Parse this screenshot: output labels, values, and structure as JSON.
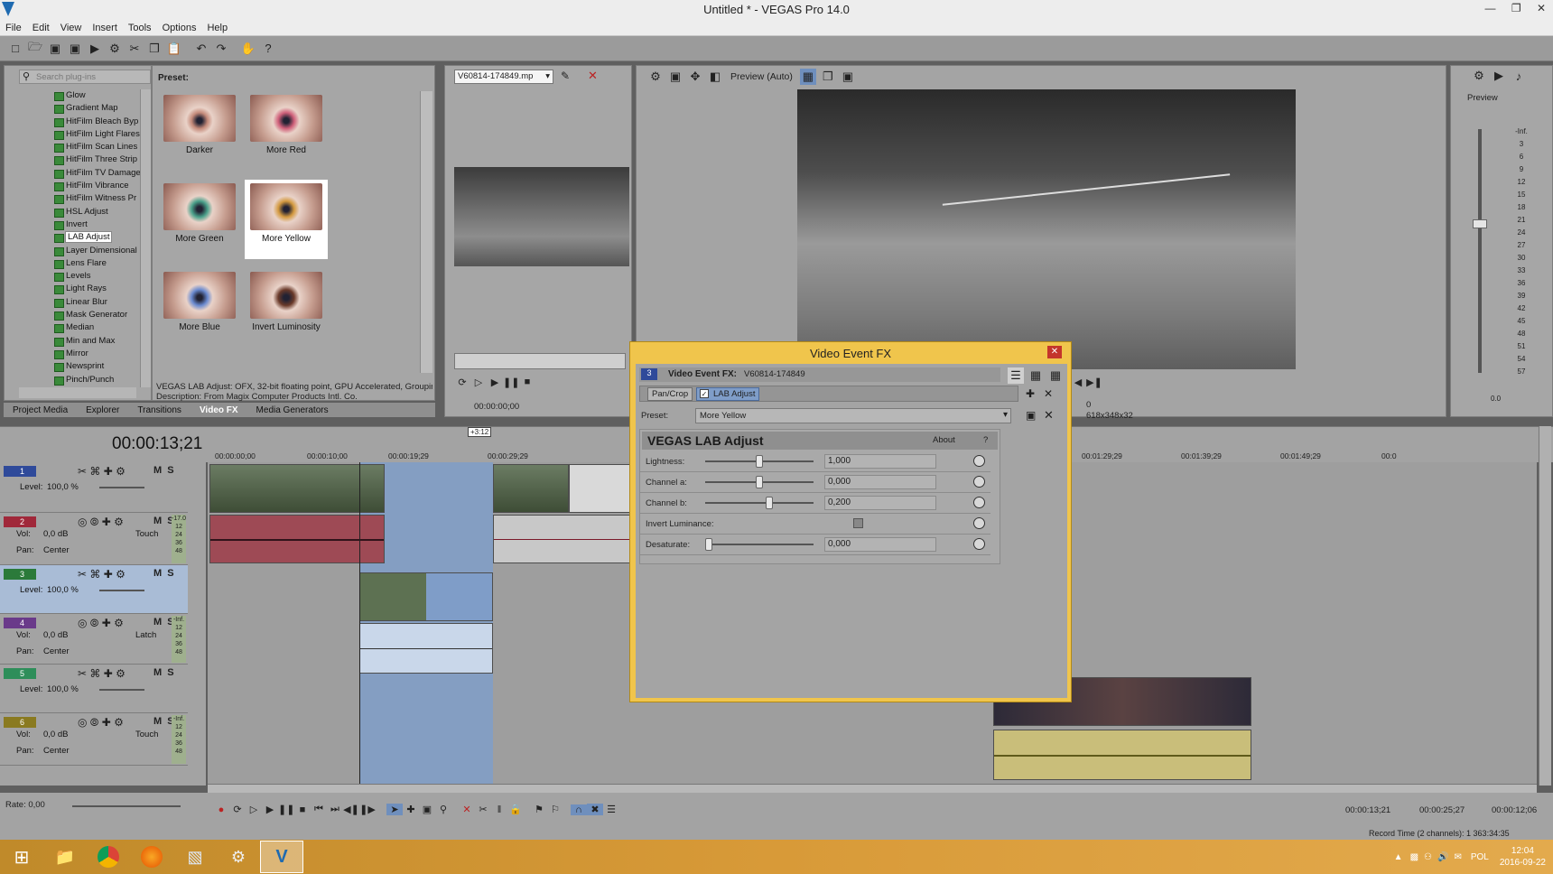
{
  "window": {
    "title": "Untitled * - VEGAS Pro 14.0"
  },
  "menu": [
    "File",
    "Edit",
    "View",
    "Insert",
    "Tools",
    "Options",
    "Help"
  ],
  "plugins": {
    "search_placeholder": "Search plug-ins",
    "items": [
      "Glow",
      "Gradient Map",
      "HitFilm Bleach Byp",
      "HitFilm Light Flares",
      "HitFilm Scan Lines",
      "HitFilm Three Strip",
      "HitFilm TV Damage",
      "HitFilm Vibrance",
      "HitFilm Witness Pr",
      "HSL Adjust",
      "Invert",
      "LAB Adjust",
      "Layer Dimensional",
      "Lens Flare",
      "Levels",
      "Light Rays",
      "Linear Blur",
      "Mask Generator",
      "Median",
      "Min and Max",
      "Mirror",
      "Newsprint",
      "Pinch/Punch"
    ],
    "selected": "LAB Adjust"
  },
  "presets": {
    "label": "Preset:",
    "items": [
      "Darker",
      "More Red",
      "More Green",
      "More Yellow",
      "More Blue",
      "Invert Luminosity"
    ],
    "selected": "More Yellow",
    "description_line1": "VEGAS LAB Adjust: OFX, 32-bit floating point, GPU Accelerated, Grouping",
    "description_line2": "Description: From Magix Computer Products Intl. Co."
  },
  "bottom_tabs": [
    "Project Media",
    "Explorer",
    "Transitions",
    "Video FX",
    "Media Generators"
  ],
  "active_tab": "Video FX",
  "trimmer": {
    "file": "V60814-174849.mp",
    "timecode": "00:00:00;00"
  },
  "preview": {
    "mode": "Preview (Auto)",
    "info": "618x348x32",
    "frame_label": "0"
  },
  "master": {
    "title": "Preview",
    "ticks": [
      "-Inf.",
      "3",
      "6",
      "9",
      "12",
      "15",
      "18",
      "21",
      "24",
      "27",
      "30",
      "33",
      "36",
      "39",
      "42",
      "45",
      "48",
      "51",
      "54",
      "57"
    ],
    "bottom": "0.0"
  },
  "timeline": {
    "current_time": "00:00:13;21",
    "ruler": [
      "00:00:00;00",
      "00:00:10;00",
      "00:00:19;29",
      "00:00:29;29",
      "00:01:20;00",
      "00:01:29;29",
      "00:01:39;29",
      "00:01:49;29",
      "00:0"
    ],
    "marker": "+3:12",
    "tracks": [
      {
        "num": "1",
        "type": "video",
        "level_label": "Level:",
        "level": "100,0 %",
        "color": "#2f4a9a"
      },
      {
        "num": "2",
        "type": "audio",
        "vol_label": "Vol:",
        "vol": "0,0 dB",
        "pan_label": "Pan:",
        "pan": "Center",
        "mode": "Touch",
        "color": "#a0283a"
      },
      {
        "num": "3",
        "type": "video",
        "level_label": "Level:",
        "level": "100,0 %",
        "color": "#2b7a3a"
      },
      {
        "num": "4",
        "type": "audio",
        "vol_label": "Vol:",
        "vol": "0,0 dB",
        "pan_label": "Pan:",
        "pan": "Center",
        "mode": "Latch",
        "color": "#6a3a8a"
      },
      {
        "num": "5",
        "type": "video",
        "level_label": "Level:",
        "level": "100,0 %",
        "color": "#2e8e5a"
      },
      {
        "num": "6",
        "type": "audio",
        "vol_label": "Vol:",
        "vol": "0,0 dB",
        "pan_label": "Pan:",
        "pan": "Center",
        "mode": "Touch",
        "color": "#8a7a20"
      }
    ],
    "meter_ticks": [
      "-17.0",
      "12",
      "24",
      "36",
      "48"
    ],
    "meter_ticks_inf": [
      "-Inf.",
      "12",
      "24",
      "36",
      "48"
    ],
    "rate": "Rate: 0,00",
    "status_time1": "00:00:13;21",
    "status_time2": "00:00:25;27",
    "status_time3": "00:00:12;06",
    "record_time": "Record Time (2 channels): 1 363:34:35"
  },
  "fx_dialog": {
    "title": "Video Event FX",
    "header_label": "Video Event FX:",
    "header_file": "V60814-174849",
    "header_badge": "3",
    "chain": [
      "Pan/Crop",
      "LAB Adjust"
    ],
    "preset_label": "Preset:",
    "preset_value": "More Yellow",
    "plugin_title": "VEGAS LAB Adjust",
    "about": "About",
    "help": "?",
    "params": [
      {
        "label": "Lightness:",
        "value": "1,000",
        "pos": 0.5
      },
      {
        "label": "Channel a:",
        "value": "0,000",
        "pos": 0.5
      },
      {
        "label": "Channel b:",
        "value": "0,200",
        "pos": 0.6
      },
      {
        "label": "Invert Luminance:",
        "value": "",
        "pos": null
      },
      {
        "label": "Desaturate:",
        "value": "0,000",
        "pos": 0.0
      }
    ]
  },
  "taskbar": {
    "lang": "POL",
    "time": "12:04",
    "date": "2016-09-22"
  },
  "colors": {
    "accent": "#f0c54c",
    "selection": "#7f9dc8",
    "panel": "#a6a6a6"
  }
}
